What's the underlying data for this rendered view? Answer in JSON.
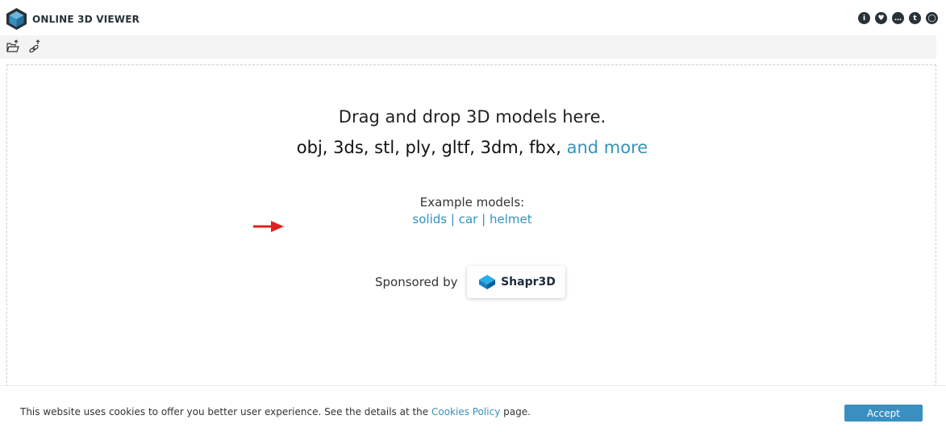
{
  "header": {
    "title": "ONLINE 3D VIEWER",
    "icons": [
      {
        "name": "info-icon",
        "glyph": "i"
      },
      {
        "name": "heart-icon",
        "glyph": "♥"
      },
      {
        "name": "chat-icon",
        "glyph": "…"
      },
      {
        "name": "twitter-icon",
        "glyph": "t"
      },
      {
        "name": "github-icon",
        "glyph": "◯"
      }
    ]
  },
  "toolbar": {
    "buttons": [
      "open-file-icon",
      "open-url-icon"
    ]
  },
  "drop": {
    "line1": "Drag and drop 3D models here.",
    "formats": "obj, 3ds, stl, ply, gltf, 3dm, fbx,",
    "more_link": "and more",
    "examples_title": "Example models:",
    "examples": [
      "solids",
      "car",
      "helmet"
    ],
    "separator": "|",
    "sponsored_by": "Sponsored by",
    "sponsor_name": "Shapr3D"
  },
  "cookie": {
    "text_before": "This website uses cookies to offer you better user experience. See the details at the",
    "policy_link": "Cookies Policy",
    "text_after": "page.",
    "accept_label": "Accept"
  },
  "colors": {
    "accent": "#3393bd",
    "button": "#3a8fc1",
    "dark": "#263238",
    "annotation_arrow": "#e0201c"
  }
}
